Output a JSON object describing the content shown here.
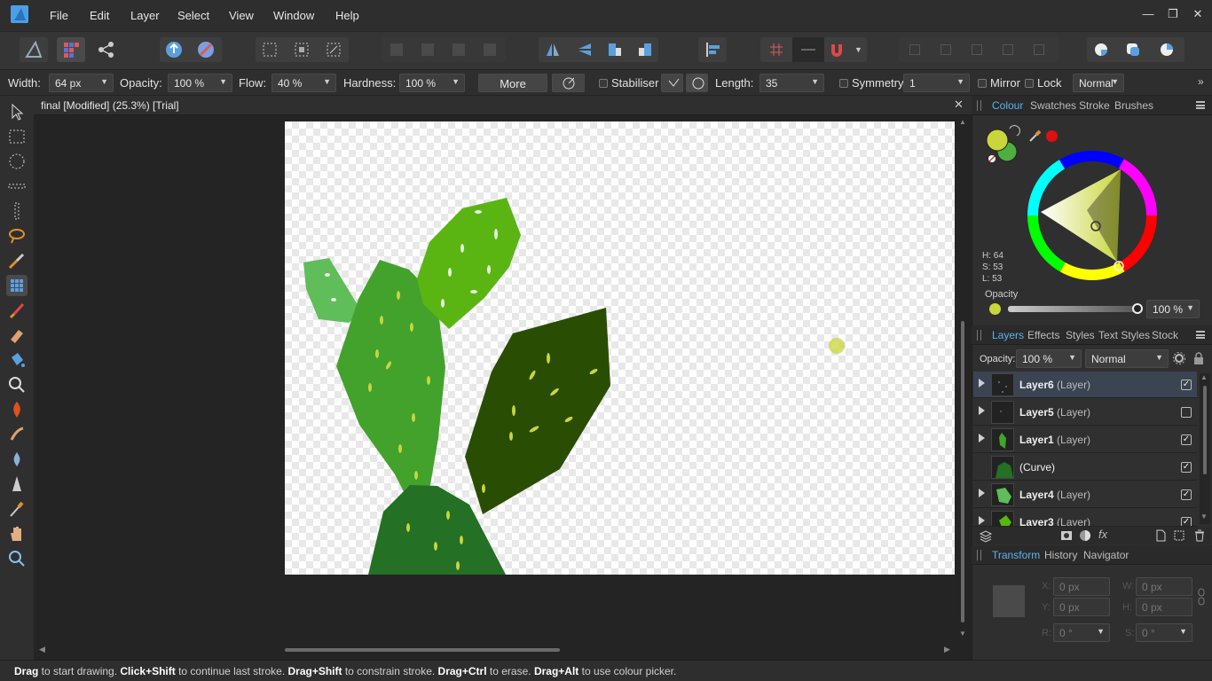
{
  "menu": [
    "File",
    "Edit",
    "Layer",
    "Select",
    "View",
    "Window",
    "Help"
  ],
  "context_bar": {
    "width_label": "Width:",
    "width_value": "64 px",
    "opacity_label": "Opacity:",
    "opacity_value": "100 %",
    "flow_label": "Flow:",
    "flow_value": "40 %",
    "hardness_label": "Hardness:",
    "hardness_value": "100 %",
    "more_label": "More",
    "stabiliser_label": "Stabiliser",
    "length_label": "Length:",
    "length_value": "35",
    "symmetry_label": "Symmetry",
    "symmetry_value": "1",
    "mirror_label": "Mirror",
    "lock_label": "Lock",
    "blend_value": "Normal"
  },
  "document": {
    "tab_title": "final [Modified] (25.3%) [Trial]"
  },
  "colour_panel": {
    "tabs": [
      "Colour",
      "Swatches",
      "Stroke",
      "Brushes"
    ],
    "h_label": "H: 64",
    "s_label": "S: 53",
    "l_label": "L: 53",
    "opacity_label": "Opacity",
    "opacity_value": "100 %",
    "primary_color": "#c8d63c",
    "secondary_color": "#4caf3e",
    "picker_color": "#e01010"
  },
  "layers_panel": {
    "tabs": [
      "Layers",
      "Effects",
      "Styles",
      "Text Styles",
      "Stock"
    ],
    "opacity_label": "Opacity:",
    "opacity_value": "100 %",
    "blend_value": "Normal",
    "layers": [
      {
        "name": "Layer6",
        "type": "(Layer)",
        "visible": "✓"
      },
      {
        "name": "Layer5",
        "type": "(Layer)",
        "visible": ""
      },
      {
        "name": "Layer1",
        "type": "(Layer)",
        "visible": "✓"
      },
      {
        "name": "(Curve)",
        "type": "",
        "visible": "✓"
      },
      {
        "name": "Layer4",
        "type": "(Layer)",
        "visible": "✓"
      },
      {
        "name": "Layer3",
        "type": "(Layer)",
        "visible": "✓"
      }
    ]
  },
  "transform_panel": {
    "tabs": [
      "Transform",
      "History",
      "Navigator"
    ],
    "x_label": "X:",
    "x_value": "0 px",
    "y_label": "Y:",
    "y_value": "0 px",
    "w_label": "W:",
    "w_value": "0 px",
    "h_label": "H:",
    "h_value": "0 px",
    "r_label": "R:",
    "r_value": "0 °",
    "s_label": "S:",
    "s_value": "0 °"
  },
  "status": {
    "p1": "Drag",
    "t1": " to start drawing. ",
    "p2": "Click+Shift",
    "t2": " to continue last stroke. ",
    "p3": "Drag+Shift",
    "t3": " to constrain stroke. ",
    "p4": "Drag+Ctrl",
    "t4": " to erase. ",
    "p5": "Drag+Alt",
    "t5": " to use colour picker."
  }
}
